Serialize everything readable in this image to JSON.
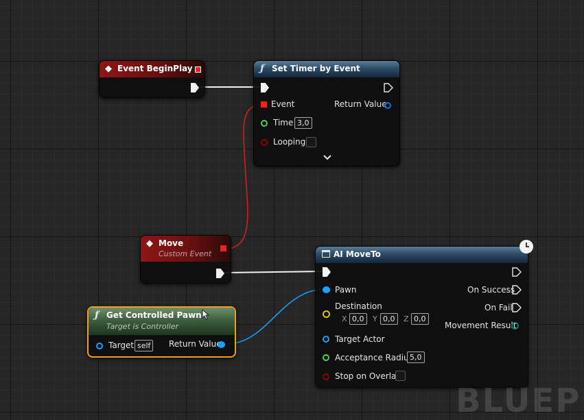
{
  "nodes": {
    "begin_play": {
      "title": "Event BeginPlay"
    },
    "set_timer": {
      "title": "Set Timer by Event",
      "pins": {
        "event": "Event",
        "return_value": "Return Value",
        "time": "Time",
        "time_value": "3,0",
        "looping": "Looping"
      }
    },
    "move": {
      "title": "Move",
      "subtitle": "Custom Event"
    },
    "get_pawn": {
      "title": "Get Controlled Pawn",
      "subtitle": "Target is Controller",
      "pins": {
        "target": "Target",
        "target_value": "self",
        "return_value": "Return Value"
      }
    },
    "ai_moveto": {
      "title": "AI MoveTo",
      "pins": {
        "pawn": "Pawn",
        "destination": "Destination",
        "dest_x_label": "X",
        "dest_x": "0,0",
        "dest_y_label": "Y",
        "dest_y": "0,0",
        "dest_z_label": "Z",
        "dest_z": "0,0",
        "target_actor": "Target Actor",
        "acceptance_radius": "Acceptance Radius",
        "acceptance_radius_value": "5,0",
        "stop_on_overlap": "Stop on Overlap",
        "on_success": "On Success",
        "on_fail": "On Fail",
        "movement_result": "Movement Result"
      }
    }
  },
  "watermark": "BLUEPR",
  "icons": {
    "event": "event-diamond-icon",
    "function": "function-f-icon",
    "latent": "clock-icon",
    "expand": "chevron-down-icon",
    "cursor": "mouse-cursor-icon",
    "macro": "node-window-icon"
  },
  "colors": {
    "event_header": "#8e1515",
    "function_header": "#2c4c66",
    "pure_header": "#3e5e3d",
    "selection": "#f0a020",
    "float_pin": "#4fd04f",
    "object_pin": "#1aa0ff",
    "vector_pin": "#e0c020",
    "bool_pin": "#8a0000",
    "delegate_pin": "#ee2222",
    "exec_pin": "#ffffff"
  }
}
